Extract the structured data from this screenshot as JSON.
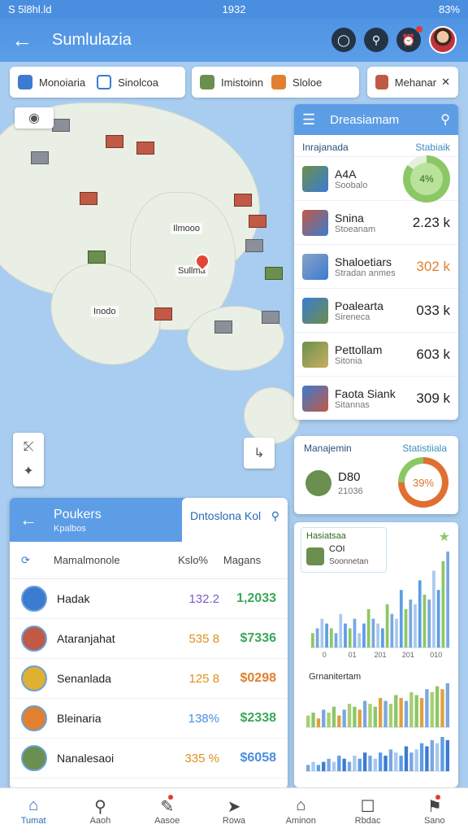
{
  "status": {
    "left": "S 5l8hl.ld",
    "time": "1932",
    "right": "83%"
  },
  "appbar": {
    "title": "Sumlulazia"
  },
  "chips": [
    "Monoiaria",
    "Sinolcoa",
    "Imistoinn",
    "Sloloe",
    "Mehanar"
  ],
  "map": {
    "labels": [
      "Ilmooo",
      "Inodo",
      "Sullma"
    ]
  },
  "right_panel": {
    "title": "Dreasiamam",
    "col_a": "Inrajanada",
    "col_b": "Stabiaik",
    "items": [
      {
        "name": "A4A",
        "sub": "Soobalo",
        "value": "4%"
      },
      {
        "name": "Snina",
        "sub": "Stoeanam",
        "value": "2.23 k"
      },
      {
        "name": "Shaloetiars",
        "sub": "Stradan anmes",
        "value": "302 k"
      },
      {
        "name": "Poalearta",
        "sub": "Sireneca",
        "value": "033 k"
      },
      {
        "name": "Pettollam",
        "sub": "Sitonia",
        "value": "603 k"
      },
      {
        "name": "Faota Siank",
        "sub": "Sitannas",
        "value": "309 k"
      }
    ]
  },
  "management": {
    "title": "Manajemin",
    "stat": "Statistiiala",
    "code": "D80",
    "sub": "21036",
    "ring": "39%"
  },
  "chart_box": {
    "title": "Hasiatsaa",
    "sub1": "COI",
    "sub2": "Soonnetan",
    "second_title": "Grnanitertam"
  },
  "chart_data": [
    {
      "type": "bar",
      "title": "",
      "x": [
        "0",
        "01",
        "201",
        "201",
        "010"
      ],
      "series": [
        {
          "name": "",
          "values": [
            3,
            4,
            6,
            5,
            4,
            3,
            7,
            5,
            4,
            6,
            3,
            5,
            8,
            6,
            5,
            4,
            9,
            7,
            6,
            12,
            8,
            10,
            9,
            14,
            11,
            10,
            16,
            12,
            18,
            20
          ]
        }
      ]
    },
    {
      "type": "bar",
      "title": "",
      "series": [
        {
          "name": "",
          "values": [
            4,
            5,
            3,
            6,
            5,
            7,
            4,
            6,
            8,
            7,
            6,
            9,
            8,
            7,
            10,
            9,
            8,
            11,
            10,
            9,
            12,
            11,
            10,
            13,
            12,
            14,
            13,
            15
          ]
        }
      ]
    },
    {
      "type": "bar",
      "title": "",
      "series": [
        {
          "name": "",
          "values": [
            2,
            3,
            2,
            3,
            4,
            3,
            5,
            4,
            3,
            5,
            4,
            6,
            5,
            4,
            6,
            5,
            7,
            6,
            5,
            8,
            6,
            7,
            9,
            8,
            10,
            9,
            11,
            10
          ]
        }
      ]
    }
  ],
  "left_panel": {
    "title": "Poukers",
    "subtitle": "Kpalbos",
    "tab": "Dntoslona Kol",
    "headers": [
      "Mamalmonole",
      "Kslo%",
      "Magans"
    ],
    "rows": [
      {
        "name": "Hadak",
        "k": "132.2",
        "m": "1,2033",
        "kc": "#7c5ac8",
        "mc": "#3aa858"
      },
      {
        "name": "Ataranjahat",
        "k": "535 8",
        "m": "$7336",
        "kc": "#e09020",
        "mc": "#3aa858"
      },
      {
        "name": "Senanlada",
        "k": "125 8",
        "m": "$0298",
        "kc": "#e09020",
        "mc": "#e08030"
      },
      {
        "name": "Bleinaria",
        "k": "138%",
        "m": "$2338",
        "kc": "#4a8ee0",
        "mc": "#3aa858"
      },
      {
        "name": "Nanalesaoi",
        "k": "335 %",
        "m": "$6058",
        "kc": "#e09020",
        "mc": "#4a8ee0"
      }
    ]
  },
  "nav": [
    "Tumat",
    "Aaoh",
    "Aasoe",
    "Rowa",
    "Aminon",
    "Rbdac",
    "Sano"
  ],
  "colors": {
    "accent": "#5d9de6",
    "green": "#3aa858",
    "orange": "#e08030"
  }
}
